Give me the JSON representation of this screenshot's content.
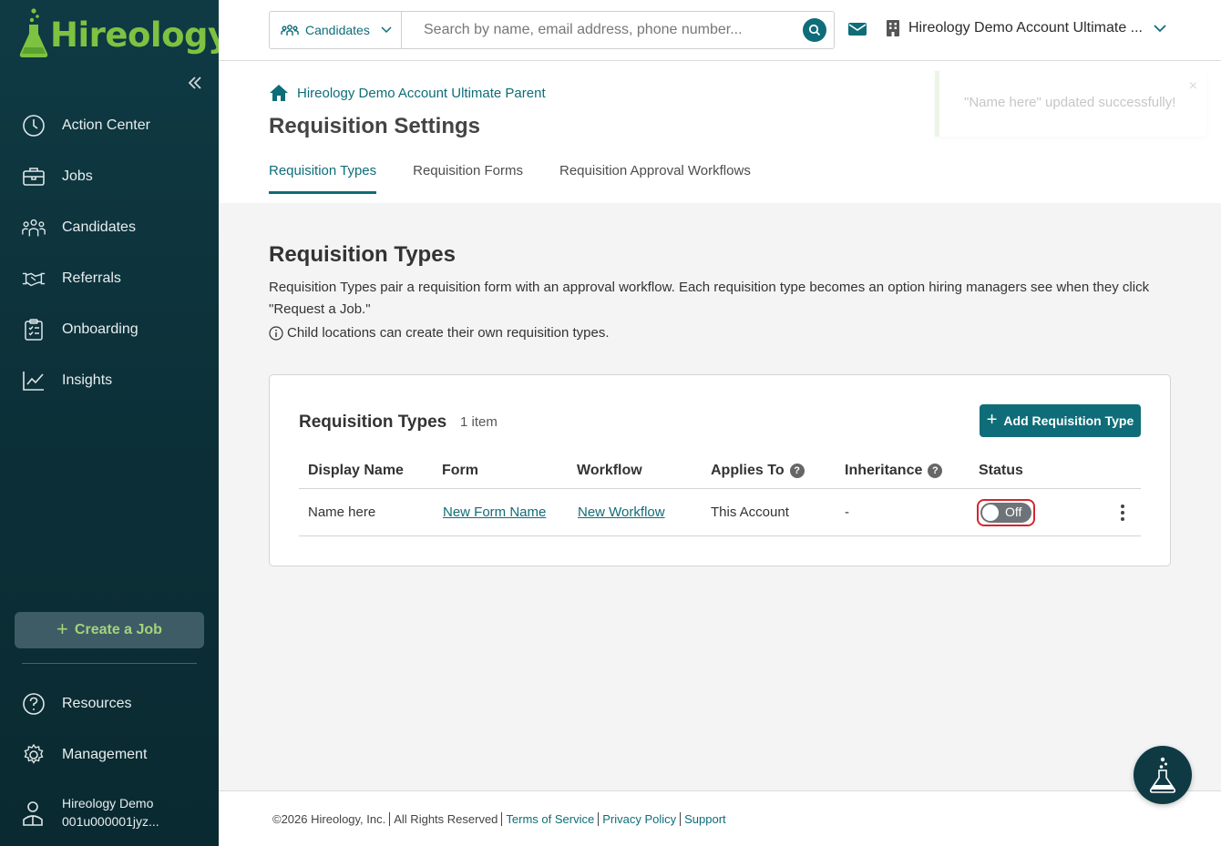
{
  "brand": {
    "name": "Hireology",
    "logo_color": "#7dc241",
    "accent": "#0e6d78",
    "sidebar_bg": "#0f3a44"
  },
  "sidebar": {
    "items": [
      {
        "label": "Action Center",
        "icon": "clock-icon"
      },
      {
        "label": "Jobs",
        "icon": "briefcase-icon"
      },
      {
        "label": "Candidates",
        "icon": "people-icon"
      },
      {
        "label": "Referrals",
        "icon": "handshake-icon"
      },
      {
        "label": "Onboarding",
        "icon": "clipboard-icon"
      },
      {
        "label": "Insights",
        "icon": "chart-line-icon"
      }
    ],
    "create_job_label": "Create a Job",
    "bottom_items": [
      {
        "label": "Resources",
        "icon": "question-icon"
      },
      {
        "label": "Management",
        "icon": "gear-icon"
      }
    ],
    "user": {
      "line1": "Hireology Demo",
      "line2": "001u000001jyz..."
    }
  },
  "header": {
    "search_scope": "Candidates",
    "search_placeholder": "Search by name, email address, phone number...",
    "account_name": "Hireology Demo Account Ultimate ..."
  },
  "breadcrumb": {
    "label": "Hireology Demo Account Ultimate Parent"
  },
  "page": {
    "title": "Requisition Settings",
    "tabs": [
      {
        "label": "Requisition Types",
        "active": true
      },
      {
        "label": "Requisition Forms",
        "active": false
      },
      {
        "label": "Requisition Approval Workflows",
        "active": false
      }
    ]
  },
  "toast": {
    "message": "\"Name here\" updated successfully!",
    "close": "×"
  },
  "section": {
    "title": "Requisition Types",
    "description": "Requisition Types pair a requisition form with an approval workflow. Each requisition type becomes an option hiring managers see when they click \"Request a Job.\"",
    "note": "Child locations can create their own requisition types."
  },
  "card": {
    "title": "Requisition Types",
    "count": "1 item",
    "add_label": "Add Requisition Type",
    "columns": [
      "Display Name",
      "Form",
      "Workflow",
      "Applies To",
      "Inheritance",
      "Status"
    ],
    "rows": [
      {
        "display_name": "Name here",
        "form": "New Form Name",
        "workflow": "New Workflow",
        "applies_to": "This Account",
        "inheritance": "-",
        "status": "Off"
      }
    ]
  },
  "footer": {
    "copyright": "©2026 Hireology, Inc.",
    "rights": "All Rights Reserved",
    "links": [
      "Terms of Service",
      "Privacy Policy",
      "Support"
    ]
  }
}
